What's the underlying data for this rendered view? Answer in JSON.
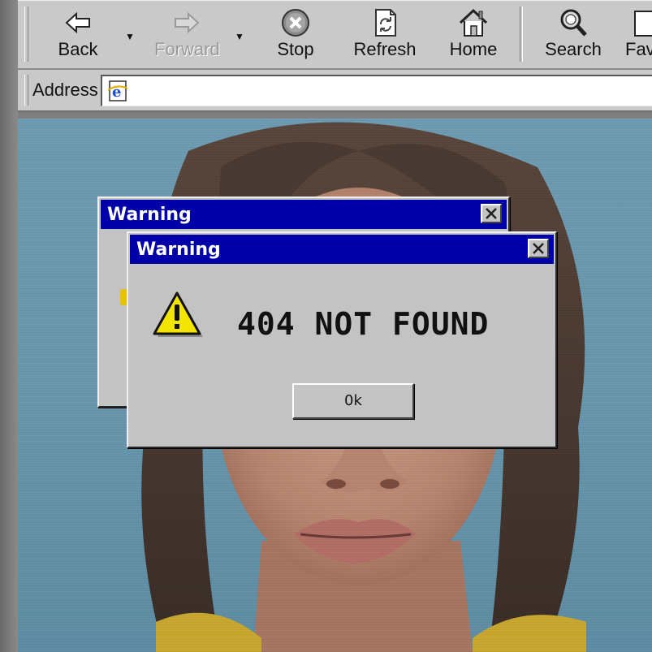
{
  "toolbar": {
    "buttons": [
      {
        "label": "Back",
        "icon": "back-arrow-icon"
      },
      {
        "label": "Forward",
        "icon": "forward-arrow-icon",
        "disabled": true
      },
      {
        "label": "Stop",
        "icon": "stop-icon"
      },
      {
        "label": "Refresh",
        "icon": "refresh-icon"
      },
      {
        "label": "Home",
        "icon": "home-icon"
      },
      {
        "label": "Search",
        "icon": "search-icon"
      },
      {
        "label": "Fav",
        "icon": "favorites-icon"
      }
    ]
  },
  "address_bar": {
    "label": "Address",
    "value": "",
    "icon": "ie-page-icon"
  },
  "dialogs": {
    "back": {
      "title": "Warning"
    },
    "front": {
      "title": "Warning",
      "message": "404 NOT FOUND",
      "ok_label": "0k",
      "icon": "warning-triangle-icon"
    }
  },
  "colors": {
    "titlebar": "#0000a8",
    "window_face": "#c3c3c3",
    "toolbar_face": "#c9c9c9",
    "background_photo": "#6a98ae"
  }
}
